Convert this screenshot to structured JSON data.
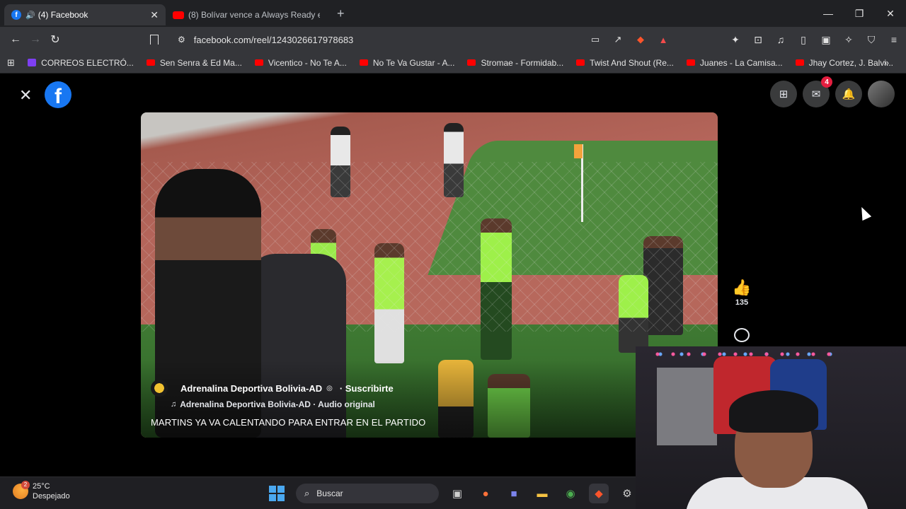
{
  "tabs": [
    {
      "title": "(4) Facebook",
      "active": true,
      "favicon": "facebook-icon",
      "audio": true
    },
    {
      "title": "(8) Bolívar vence a Always Ready en l",
      "active": false,
      "favicon": "youtube-icon"
    }
  ],
  "address_bar": {
    "url": "facebook.com/reel/1243026617978683"
  },
  "bookmarks": [
    {
      "label": "CORREOS ELECTRÓ...",
      "icon": "mail-icon"
    },
    {
      "label": "Sen Senra & Ed Ma...",
      "icon": "youtube-icon"
    },
    {
      "label": "Vicentico - No Te A...",
      "icon": "youtube-icon"
    },
    {
      "label": "No Te Va Gustar - A...",
      "icon": "youtube-icon"
    },
    {
      "label": "Stromae - Formidab...",
      "icon": "youtube-icon"
    },
    {
      "label": "Twist And Shout (Re...",
      "icon": "youtube-icon"
    },
    {
      "label": "Juanes - La Camisa...",
      "icon": "youtube-icon"
    },
    {
      "label": "Jhay Cortez, J. Balvi...",
      "icon": "youtube-icon"
    }
  ],
  "facebook": {
    "messenger_badge": "4",
    "reel": {
      "page_name": "Adrenalina Deportiva Bolivia-AD",
      "subscribe_label": "· Suscribirte",
      "audio_line": "Adrenalina Deportiva Bolivia-AD · Audio original",
      "caption": "MARTINS YA VA CALENTANDO PARA ENTRAR EN EL PARTIDO",
      "likes": "135"
    }
  },
  "taskbar": {
    "weather_temp": "25°C",
    "weather_desc": "Despejado",
    "weather_badge": "2",
    "search_placeholder": "Buscar"
  },
  "colors": {
    "facebook_blue": "#1877f2",
    "notification_red": "#e41e3f",
    "youtube_red": "#ff0000"
  }
}
